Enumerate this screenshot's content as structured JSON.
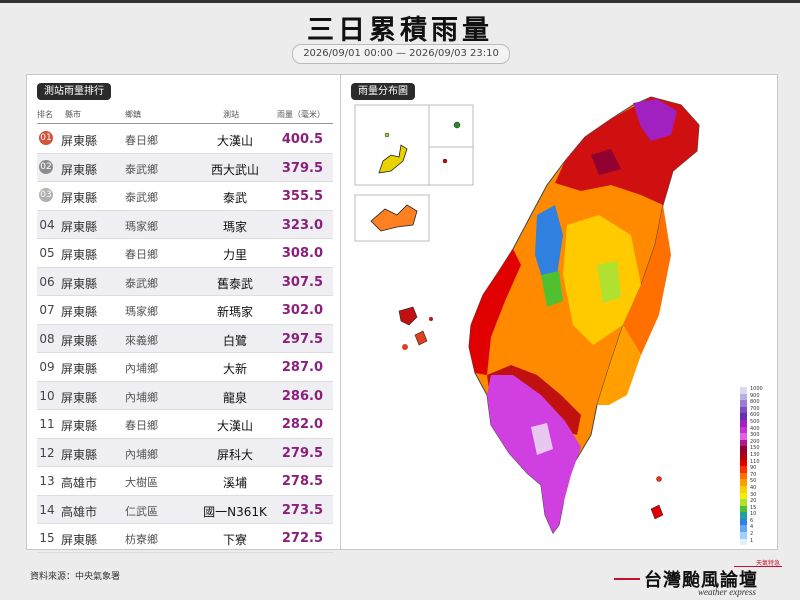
{
  "title": "三日累積雨量",
  "date_range": "2026/09/01 00:00 — 2026/09/03 23:10",
  "left_panel": {
    "title": "測站雨量排行",
    "headers": {
      "rank": "排名",
      "county": "縣市",
      "town": "鄉鎮",
      "station": "測站",
      "rain": "雨量（毫米）"
    },
    "rows": [
      {
        "rank": "01",
        "county": "屏東縣",
        "town": "春日鄉",
        "station": "大漢山",
        "rain": "400.5"
      },
      {
        "rank": "02",
        "county": "屏東縣",
        "town": "泰武鄉",
        "station": "西大武山",
        "rain": "379.5"
      },
      {
        "rank": "03",
        "county": "屏東縣",
        "town": "泰武鄉",
        "station": "泰武",
        "rain": "355.5"
      },
      {
        "rank": "04",
        "county": "屏東縣",
        "town": "瑪家鄉",
        "station": "瑪家",
        "rain": "323.0"
      },
      {
        "rank": "05",
        "county": "屏東縣",
        "town": "春日鄉",
        "station": "力里",
        "rain": "308.0"
      },
      {
        "rank": "06",
        "county": "屏東縣",
        "town": "泰武鄉",
        "station": "舊泰武",
        "rain": "307.5"
      },
      {
        "rank": "07",
        "county": "屏東縣",
        "town": "瑪家鄉",
        "station": "新瑪家",
        "rain": "302.0"
      },
      {
        "rank": "08",
        "county": "屏東縣",
        "town": "來義鄉",
        "station": "白鷺",
        "rain": "297.5"
      },
      {
        "rank": "09",
        "county": "屏東縣",
        "town": "內埔鄉",
        "station": "大新",
        "rain": "287.0"
      },
      {
        "rank": "10",
        "county": "屏東縣",
        "town": "內埔鄉",
        "station": "龍泉",
        "rain": "286.0"
      },
      {
        "rank": "11",
        "county": "屏東縣",
        "town": "春日鄉",
        "station": "大漢山",
        "rain": "282.0"
      },
      {
        "rank": "12",
        "county": "屏東縣",
        "town": "內埔鄉",
        "station": "屏科大",
        "rain": "279.5"
      },
      {
        "rank": "13",
        "county": "高雄市",
        "town": "大樹區",
        "station": "溪埔",
        "rain": "278.5"
      },
      {
        "rank": "14",
        "county": "高雄市",
        "town": "仁武區",
        "station": "國一N361K",
        "rain": "273.5"
      },
      {
        "rank": "15",
        "county": "屏東縣",
        "town": "枋寮鄉",
        "station": "下寮",
        "rain": "272.5"
      }
    ],
    "medal_colors": [
      "#d2533c",
      "#8c8c8c",
      "#b0b0b0"
    ]
  },
  "right_panel": {
    "title": "雨量分布圖",
    "legend": [
      {
        "label": "1000",
        "color": "#d9d9f0"
      },
      {
        "label": "900",
        "color": "#b8b0e0"
      },
      {
        "label": "800",
        "color": "#9a7fd0"
      },
      {
        "label": "700",
        "color": "#7b4fc0"
      },
      {
        "label": "600",
        "color": "#6a2fb0"
      },
      {
        "label": "500",
        "color": "#a020c0"
      },
      {
        "label": "400",
        "color": "#c830d0"
      },
      {
        "label": "300",
        "color": "#e060e8"
      },
      {
        "label": "200",
        "color": "#b01890"
      },
      {
        "label": "150",
        "color": "#900030"
      },
      {
        "label": "130",
        "color": "#b00010"
      },
      {
        "label": "110",
        "color": "#e00000"
      },
      {
        "label": "90",
        "color": "#ff3000"
      },
      {
        "label": "70",
        "color": "#ff7000"
      },
      {
        "label": "50",
        "color": "#ffa000"
      },
      {
        "label": "40",
        "color": "#ffd000"
      },
      {
        "label": "30",
        "color": "#f0f000"
      },
      {
        "label": "20",
        "color": "#b0e030"
      },
      {
        "label": "15",
        "color": "#50c030"
      },
      {
        "label": "10",
        "color": "#20a0a0"
      },
      {
        "label": "6",
        "color": "#3080e0"
      },
      {
        "label": "4",
        "color": "#60a8f0"
      },
      {
        "label": "2",
        "color": "#a0d0f8"
      },
      {
        "label": "1",
        "color": "#e0f0ff"
      }
    ]
  },
  "footer": {
    "source": "資料來源：中央氣象署",
    "logo_title": "台灣颱風論壇",
    "logo_subtitle": "weather express",
    "logo_tag": "天氣特急"
  },
  "colors": {
    "accent": "#8a1f7c",
    "logo_red": "#c8102e"
  }
}
